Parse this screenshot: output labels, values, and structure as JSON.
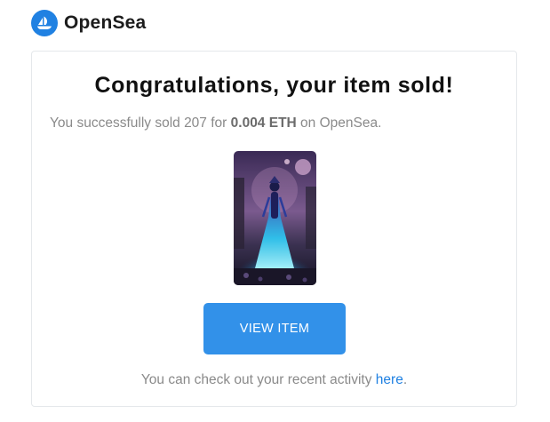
{
  "brand": {
    "name": "OpenSea",
    "logo_icon": "opensea-sailboat-icon",
    "color": "#2081e2"
  },
  "email": {
    "title": "Congratulations, your item sold!",
    "message": {
      "prefix": "You successfully sold 207 for ",
      "price": "0.004 ETH",
      "suffix": " on OpenSea."
    },
    "item_image": "nft-artwork-glowing-figure",
    "button_label": "VIEW ITEM",
    "footer": {
      "prefix": "You can check out your recent activity ",
      "link_text": "here",
      "suffix": "."
    }
  },
  "colors": {
    "accent": "#2081e2",
    "button": "#3291e9",
    "muted_text": "#8a8a8a"
  }
}
